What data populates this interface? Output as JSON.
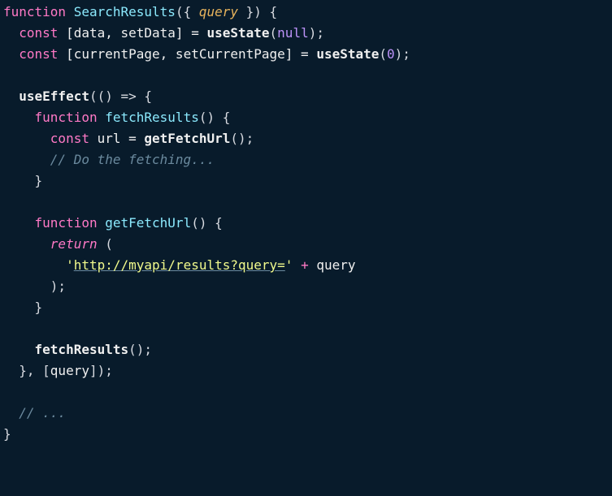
{
  "code": {
    "l1_fn": "function",
    "l1_name": "SearchResults",
    "l1_paramOpen": "({ ",
    "l1_param": "query",
    "l1_paramClose": " }) {",
    "l2_const": "const",
    "l2_destruct": " [data, setData] = ",
    "l2_useState": "useState",
    "l2_argOpen": "(",
    "l2_null": "null",
    "l2_argClose": ");",
    "l3_const": "const",
    "l3_destruct": " [currentPage, setCurrentPage] = ",
    "l3_useState": "useState",
    "l3_argOpen": "(",
    "l3_zero": "0",
    "l3_argClose": ");",
    "l5_useEffect": "useEffect",
    "l5_arrow": "(() => {",
    "l6_fn": "function",
    "l6_name": "fetchResults",
    "l6_sig": "() {",
    "l7_const": "const",
    "l7_url": " url = ",
    "l7_getFetchUrl": "getFetchUrl",
    "l7_call": "();",
    "l8_comment": "// Do the fetching...",
    "l9_close": "}",
    "l11_fn": "function",
    "l11_name": "getFetchUrl",
    "l11_sig": "() {",
    "l12_return": "return",
    "l12_paren": " (",
    "l13_q1": "'",
    "l13_url": "http://myapi/results?query=",
    "l13_q2": "'",
    "l13_plus": " + ",
    "l13_query": "query",
    "l14_close": ");",
    "l15_close": "}",
    "l17_call": "fetchResults",
    "l17_parens": "();",
    "l18_close": "}, [",
    "l18_query": "query",
    "l18_close2": "]);",
    "l20_comment": "// ...",
    "l21_close": "}"
  }
}
